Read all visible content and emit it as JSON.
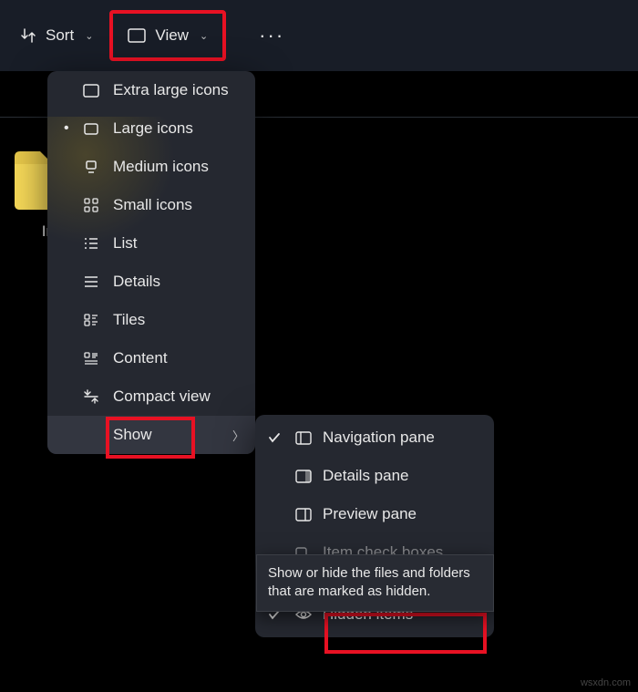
{
  "toolbar": {
    "sort_label": "Sort",
    "view_label": "View",
    "more_label": "···"
  },
  "folder": {
    "name": "Intr"
  },
  "view_menu": {
    "items": [
      {
        "label": "Extra large icons"
      },
      {
        "label": "Large icons"
      },
      {
        "label": "Medium icons"
      },
      {
        "label": "Small icons"
      },
      {
        "label": "List"
      },
      {
        "label": "Details"
      },
      {
        "label": "Tiles"
      },
      {
        "label": "Content"
      },
      {
        "label": "Compact view"
      },
      {
        "label": "Show"
      }
    ]
  },
  "show_submenu": {
    "items": [
      {
        "label": "Navigation pane"
      },
      {
        "label": "Details pane"
      },
      {
        "label": "Preview pane"
      },
      {
        "label": "Item check boxes"
      },
      {
        "label": "Hidden items"
      }
    ]
  },
  "tooltip": "Show or hide the files and folders that are marked as hidden.",
  "watermark": "wsxdn.com"
}
